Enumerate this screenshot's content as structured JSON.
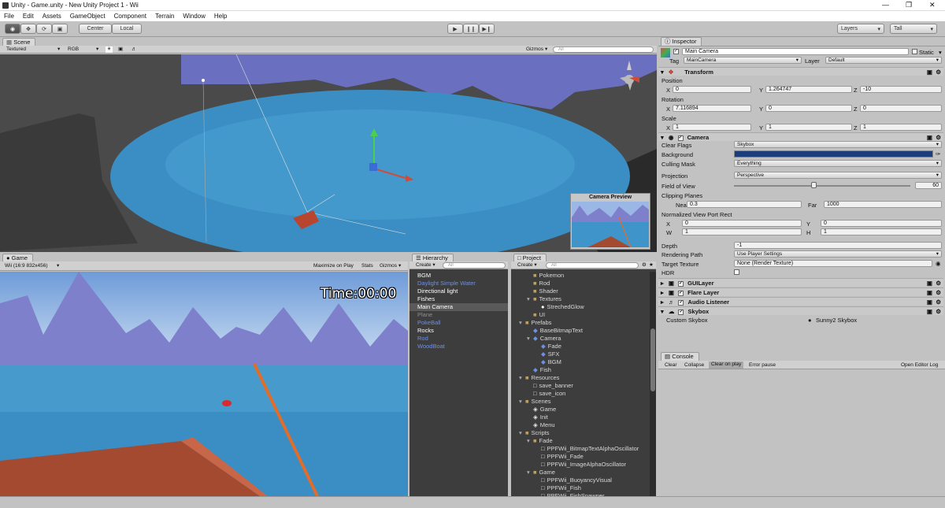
{
  "window": {
    "title": "Unity - Game.unity - New Unity Project 1 - Wii",
    "min": "—",
    "max": "❐",
    "close": "✕"
  },
  "menu": [
    "File",
    "Edit",
    "Assets",
    "GameObject",
    "Component",
    "Terrain",
    "Window",
    "Help"
  ],
  "toolbar": {
    "center": "Center",
    "local": "Local",
    "layers": "Layers",
    "layout": "Tall"
  },
  "scene": {
    "tab": "Scene",
    "shading": "Textured",
    "render": "RGB",
    "gizmos": "Gizmos",
    "search": "All",
    "preview_title": "Camera Preview"
  },
  "game": {
    "tab": "Game",
    "aspect": "Wii (16:9 832x456)",
    "maximize": "Maximize on Play",
    "stats": "Stats",
    "gizmos": "Gizmos",
    "hud_time": "Time:00:00"
  },
  "hierarchy": {
    "tab": "Hierarchy",
    "create": "Create",
    "search": "All",
    "items": [
      {
        "label": "BGM",
        "color": "#ffffff",
        "selected": false
      },
      {
        "label": "Daylight Simple Water",
        "color": "#6d8fe6",
        "selected": false
      },
      {
        "label": "Directional light",
        "color": "#ffffff",
        "selected": false
      },
      {
        "label": "Fishes",
        "color": "#ffffff",
        "selected": false
      },
      {
        "label": "Main Camera",
        "color": "#ffffff",
        "selected": true
      },
      {
        "label": "Plane",
        "color": "#8e8e8e",
        "selected": false
      },
      {
        "label": "PokeBall",
        "color": "#6d8fe6",
        "selected": false
      },
      {
        "label": "Rocks",
        "color": "#ffffff",
        "selected": false
      },
      {
        "label": "Rod",
        "color": "#6d8fe6",
        "selected": false
      },
      {
        "label": "WoodBoat",
        "color": "#6d8fe6",
        "selected": false
      }
    ]
  },
  "project": {
    "tab": "Project",
    "create": "Create",
    "search": "All",
    "items": [
      {
        "label": "Pokemon",
        "depth": 2,
        "type": "folder",
        "exp": ""
      },
      {
        "label": "Rod",
        "depth": 2,
        "type": "folder",
        "exp": ""
      },
      {
        "label": "Shader",
        "depth": 2,
        "type": "folder",
        "exp": ""
      },
      {
        "label": "Textures",
        "depth": 2,
        "type": "folder",
        "exp": "▾"
      },
      {
        "label": "StrechedGlow",
        "depth": 3,
        "type": "glow",
        "exp": ""
      },
      {
        "label": "UI",
        "depth": 2,
        "type": "folder",
        "exp": ""
      },
      {
        "label": "Prefabs",
        "depth": 1,
        "type": "folder",
        "exp": "▾"
      },
      {
        "label": "BaseBitmapText",
        "depth": 2,
        "type": "cube",
        "exp": ""
      },
      {
        "label": "Camera",
        "depth": 2,
        "type": "cube",
        "exp": "▾"
      },
      {
        "label": "Fade",
        "depth": 3,
        "type": "cube",
        "exp": ""
      },
      {
        "label": "SFX",
        "depth": 3,
        "type": "cube",
        "exp": ""
      },
      {
        "label": "BGM",
        "depth": 3,
        "type": "cube",
        "exp": ""
      },
      {
        "label": "Fish",
        "depth": 2,
        "type": "cube",
        "exp": ""
      },
      {
        "label": "Resources",
        "depth": 1,
        "type": "folder",
        "exp": "▾"
      },
      {
        "label": "save_banner",
        "depth": 2,
        "type": "file",
        "exp": ""
      },
      {
        "label": "save_icon",
        "depth": 2,
        "type": "file",
        "exp": ""
      },
      {
        "label": "Scenes",
        "depth": 1,
        "type": "folder",
        "exp": "▾"
      },
      {
        "label": "Game",
        "depth": 2,
        "type": "unity",
        "exp": ""
      },
      {
        "label": "Init",
        "depth": 2,
        "type": "unity",
        "exp": ""
      },
      {
        "label": "Menu",
        "depth": 2,
        "type": "unity",
        "exp": ""
      },
      {
        "label": "Scripts",
        "depth": 1,
        "type": "folder",
        "exp": "▾"
      },
      {
        "label": "Fade",
        "depth": 2,
        "type": "folder",
        "exp": "▾"
      },
      {
        "label": "PPFWii_BitmapTextAlphaOscillator",
        "depth": 3,
        "type": "file",
        "exp": ""
      },
      {
        "label": "PPFWii_Fade",
        "depth": 3,
        "type": "file",
        "exp": ""
      },
      {
        "label": "PPFWii_ImageAlphaOscillator",
        "depth": 3,
        "type": "file",
        "exp": ""
      },
      {
        "label": "Game",
        "depth": 2,
        "type": "folder",
        "exp": "▾"
      },
      {
        "label": "PPFWii_BuoyancyVisual",
        "depth": 3,
        "type": "file",
        "exp": ""
      },
      {
        "label": "PPFWii_Fish",
        "depth": 3,
        "type": "file",
        "exp": ""
      },
      {
        "label": "PPFWii_FishSpawner",
        "depth": 3,
        "type": "file",
        "exp": ""
      }
    ]
  },
  "inspector": {
    "tab": "Inspector",
    "object_name": "Main Camera",
    "static_label": "Static",
    "tag_label": "Tag",
    "tag_value": "MainCamera",
    "layer_label": "Layer",
    "layer_value": "Default",
    "transform": {
      "title": "Transform",
      "position": "Position",
      "rotation": "Rotation",
      "scale": "Scale",
      "pos": {
        "x": "0",
        "y": "1.264747",
        "z": "-10"
      },
      "rot": {
        "x": "7.116894",
        "y": "0",
        "z": "0"
      },
      "scl": {
        "x": "1",
        "y": "1",
        "z": "1"
      }
    },
    "camera": {
      "title": "Camera",
      "clear_flags": "Clear Flags",
      "clear_flags_value": "Skybox",
      "background": "Background",
      "background_color": "#1c3d7a",
      "culling_mask": "Culling Mask",
      "culling_mask_value": "Everything",
      "projection": "Projection",
      "projection_value": "Perspective",
      "fov": "Field of View",
      "fov_value": "60",
      "fov_fraction": 0.45,
      "clipping": "Clipping Planes",
      "near_label": "Near",
      "near": "0.3",
      "far_label": "Far",
      "far": "1000",
      "viewport": "Normalized View Port Rect",
      "vx": "0",
      "vy": "0",
      "vw": "1",
      "vh": "1",
      "depth": "Depth",
      "depth_value": "-1",
      "rendering_path": "Rendering Path",
      "rendering_path_value": "Use Player Settings",
      "target_texture": "Target Texture",
      "target_texture_value": "None (Render Texture)",
      "hdr": "HDR"
    },
    "components": [
      "GUILayer",
      "Flare Layer",
      "Audio Listener",
      "Skybox"
    ],
    "custom_skybox": "Custom Skybox",
    "custom_skybox_value": "Sunny2 Skybox"
  },
  "console": {
    "tab": "Console",
    "buttons": [
      "Clear",
      "Collapse",
      "Clear on play",
      "Error pause"
    ],
    "open_log": "Open Editor Log"
  },
  "colors": {
    "sky_scene": "#6b6fc0",
    "water": "#3a8ec4",
    "mountains": "#7e80cc",
    "selection": "#3d6fd0"
  }
}
